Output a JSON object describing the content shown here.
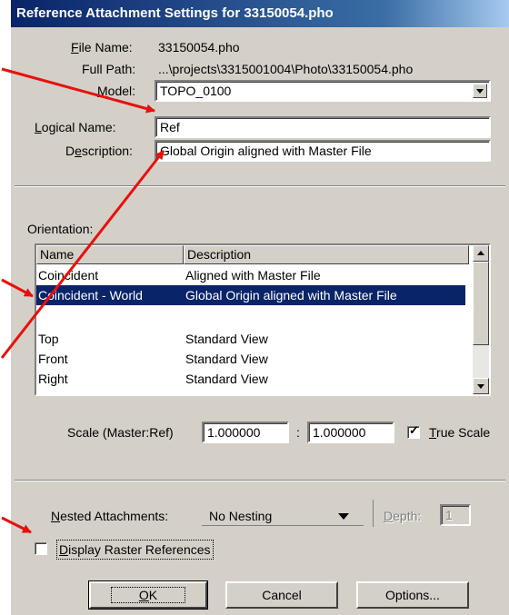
{
  "window": {
    "title": "Reference Attachment Settings for 33150054.pho"
  },
  "file": {
    "name_label": "File Name:",
    "name_value": "33150054.pho",
    "path_label": "Full Path:",
    "path_value": "...\\projects\\3315001004\\Photo\\33150054.pho",
    "model_label": "Model:",
    "model_value": "TOPO_0100",
    "logical_label": "Logical Name:",
    "logical_value": "Ref",
    "description_label": "Description:",
    "description_value": "Global Origin aligned with Master File"
  },
  "orientation": {
    "group_label": "Orientation:",
    "columns": [
      "Name",
      "Description"
    ],
    "rows": [
      {
        "name": "Coincident",
        "description": "Aligned with Master File",
        "selected": false
      },
      {
        "name": "Coincident - World",
        "description": "Global Origin aligned with Master File",
        "selected": true
      },
      {
        "name": "",
        "description": "",
        "selected": false
      },
      {
        "name": "Top",
        "description": "Standard View",
        "selected": false
      },
      {
        "name": "Front",
        "description": "Standard View",
        "selected": false
      },
      {
        "name": "Right",
        "description": "Standard View",
        "selected": false
      }
    ]
  },
  "scale": {
    "label": "Scale (Master:Ref)",
    "master_value": "1.000000",
    "separator": ":",
    "ref_value": "1.000000",
    "true_scale_label": "True Scale",
    "true_scale_checked": true
  },
  "nesting": {
    "label": "Nested Attachments:",
    "value": "No Nesting",
    "depth_label": "Depth:",
    "depth_value": "1"
  },
  "raster": {
    "label": "Display Raster References",
    "checked": false
  },
  "buttons": {
    "ok": "OK",
    "cancel": "Cancel",
    "options": "Options..."
  },
  "colors": {
    "title_bar": "#0a246a",
    "selection": "#0a246a",
    "dialog_bg": "#d4d0c8",
    "annotation_arrow": "#e8100c"
  }
}
